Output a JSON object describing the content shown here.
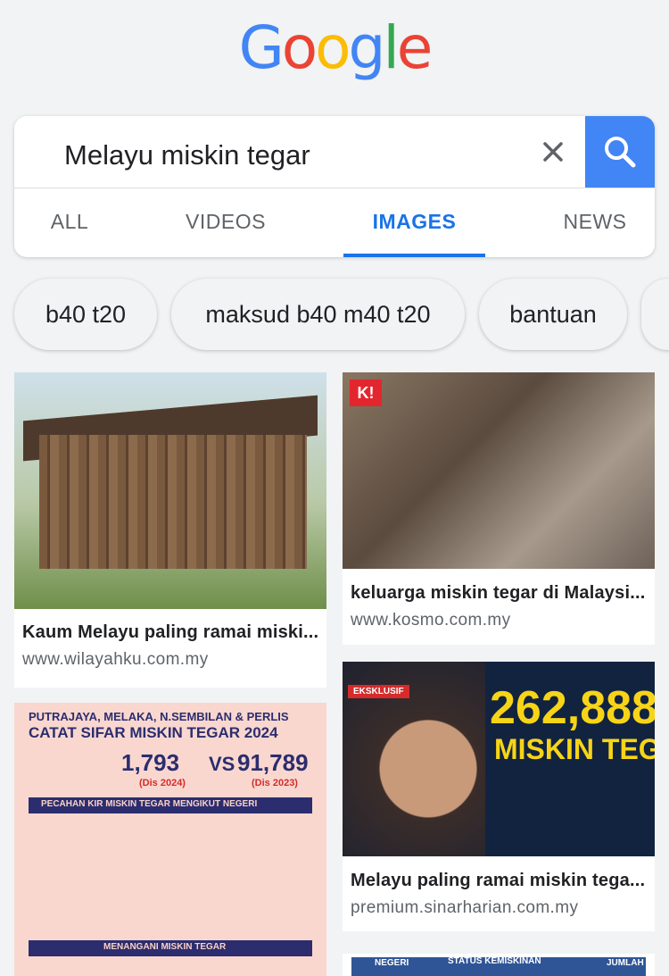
{
  "logo": {
    "letters": [
      "G",
      "o",
      "o",
      "g",
      "l",
      "e"
    ],
    "colors": [
      "#4285f4",
      "#ea4335",
      "#fbbc05",
      "#4285f4",
      "#34a853",
      "#ea4335"
    ]
  },
  "search": {
    "query": "Melayu miskin tegar"
  },
  "tabs": [
    {
      "label": "ALL",
      "active": false
    },
    {
      "label": "VIDEOS",
      "active": false
    },
    {
      "label": "IMAGES",
      "active": true
    },
    {
      "label": "NEWS",
      "active": false
    }
  ],
  "chips": [
    {
      "label": "b40 t20"
    },
    {
      "label": "maksud b40 m40 t20"
    },
    {
      "label": "bantuan"
    }
  ],
  "results": [
    {
      "title": "Kaum Melayu paling ramai miski...",
      "url": "www.wilayahku.com.my"
    },
    {
      "title": "keluarga miskin tegar di Malaysi...",
      "url": "www.kosmo.com.my",
      "badge": "K!"
    },
    {
      "title": "Melayu paling ramai miskin tega...",
      "url": "premium.sinarharian.com.my",
      "tag": "EKSKLUSIF",
      "headline_number": "262,888",
      "headline_text": "MISKIN TEGAR"
    },
    {
      "poster": {
        "line1": "PUTRAJAYA, MELAKA, N.SEMBILAN & PERLIS",
        "line2": "CATAT SIFAR MISKIN TEGAR 2024",
        "num1": "1,793",
        "vs": "VS",
        "num2": "91,789",
        "year1": "(Dis 2024)",
        "year2": "(Dis 2023)",
        "band1": "PECAHAN KIR MISKIN TEGAR MENGIKUT NEGERI",
        "band2": "MENANGANI MISKIN TEGAR"
      }
    }
  ],
  "partial_table": {
    "col1": "NEGERI",
    "col2": "STATUS KEMISKINAN",
    "col3": "JUMLAH"
  },
  "colors": {
    "accent": "#1a73e8",
    "search_button": "#4285f4",
    "background": "#f1f3f4"
  }
}
